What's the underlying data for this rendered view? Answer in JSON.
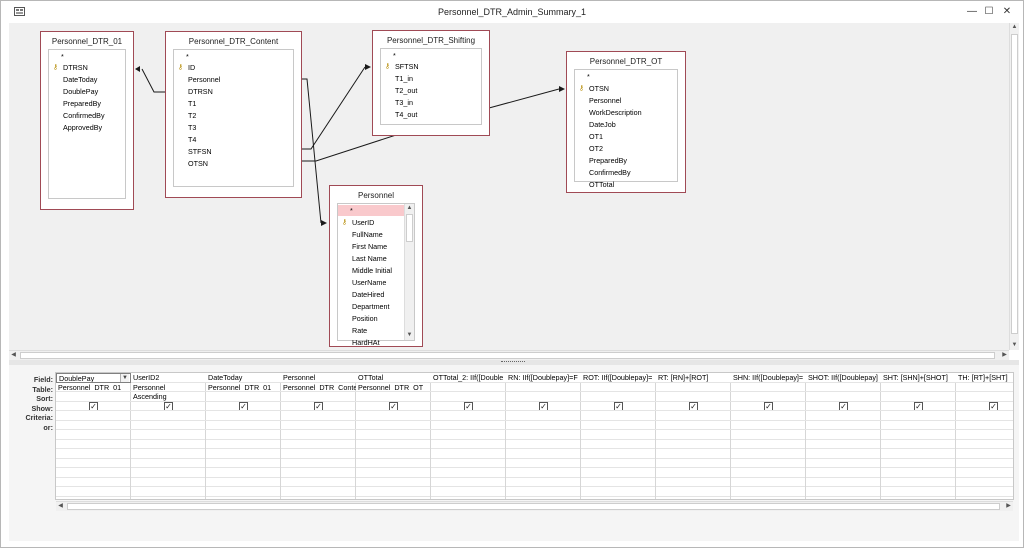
{
  "window": {
    "title": "Personnel_DTR_Admin_Summary_1",
    "minimize_glyph": "—",
    "maximize_glyph": "☐",
    "close_glyph": "✕"
  },
  "tables": [
    {
      "name": "Personnel_DTR_01",
      "key": "DTRSN",
      "fields": [
        "DateToday",
        "DoublePay",
        "PreparedBy",
        "ConfirmedBy",
        "ApprovedBy"
      ]
    },
    {
      "name": "Personnel_DTR_Content",
      "key": "ID",
      "fields": [
        "Personnel",
        "DTRSN",
        "T1",
        "T2",
        "T3",
        "T4",
        "STFSN",
        "OTSN"
      ]
    },
    {
      "name": "Personnel_DTR_Shifting",
      "key": "SFTSN",
      "fields": [
        "T1_in",
        "T2_out",
        "T3_in",
        "T4_out"
      ]
    },
    {
      "name": "Personnel_DTR_OT",
      "key": "OTSN",
      "fields": [
        "Personnel",
        "WorkDescription",
        "DateJob",
        "OT1",
        "OT2",
        "PreparedBy",
        "ConfirmedBy",
        "OTTotal"
      ]
    },
    {
      "name": "Personnel",
      "key": "UserID",
      "fields": [
        "FullName",
        "First Name",
        "Last Name",
        "Middle Initial",
        "UserName",
        "DateHired",
        "Department",
        "Position",
        "Rate",
        "HardHAt"
      ]
    }
  ],
  "star": "*",
  "grid": {
    "row_labels": [
      "Field:",
      "Table:",
      "Sort:",
      "Show:",
      "Criteria:",
      "or:"
    ],
    "columns": [
      {
        "field": "DoublePay",
        "table": "Personnel_DTR_01",
        "sort": "",
        "show": true
      },
      {
        "field": "UserID2",
        "table": "Personnel",
        "sort": "Ascending",
        "show": true
      },
      {
        "field": "DateToday",
        "table": "Personnel_DTR_01",
        "sort": "",
        "show": true
      },
      {
        "field": "Personnel",
        "table": "Personnel_DTR_Conte",
        "sort": "",
        "show": true
      },
      {
        "field": "OTTotal",
        "table": "Personnel_DTR_OT",
        "sort": "",
        "show": true
      },
      {
        "field": "OTTotal_2: IIf([Double",
        "table": "",
        "sort": "",
        "show": true
      },
      {
        "field": "RN: IIf([Doublepay]=F",
        "table": "",
        "sort": "",
        "show": true
      },
      {
        "field": "ROT: IIf([Doublepay]=",
        "table": "",
        "sort": "",
        "show": true
      },
      {
        "field": "RT: [RN]+[ROT]",
        "table": "",
        "sort": "",
        "show": true
      },
      {
        "field": "SHN: IIf([Doublepay]=",
        "table": "",
        "sort": "",
        "show": true
      },
      {
        "field": "SHOT: IIf([Doublepay]",
        "table": "",
        "sort": "",
        "show": true
      },
      {
        "field": "SHT: [SHN]+[SHOT]",
        "table": "",
        "sort": "",
        "show": true
      },
      {
        "field": "TH: [RT]+[SHT]",
        "table": "",
        "sort": "",
        "show": true
      }
    ]
  },
  "icons": {
    "key": "key-icon",
    "check": "✓",
    "arrow_up": "▲",
    "arrow_down": "▼",
    "arrow_left": "◀",
    "arrow_right": "▶"
  }
}
